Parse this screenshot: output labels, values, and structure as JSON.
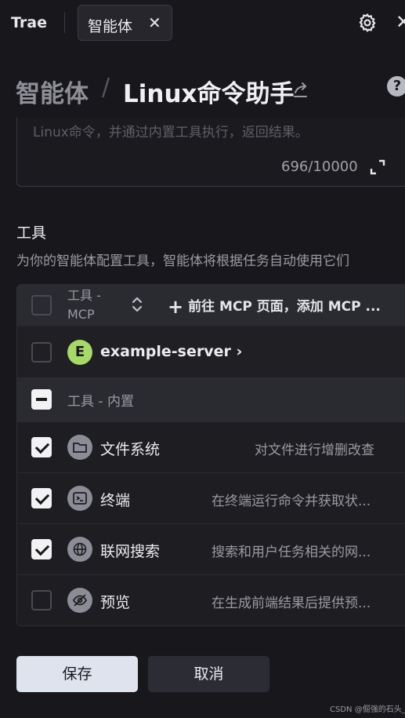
{
  "topbar": {
    "app_name": "Trae",
    "tab_label": "智能体",
    "tab_close": "✕",
    "window_close": "✕"
  },
  "header": {
    "breadcrumb_root": "智能体",
    "breadcrumb_sep": "/",
    "page_title": "Linux命令助手",
    "help": "?"
  },
  "prompt": {
    "text_fragment": "Linux命令，并通过内置工具执行，返回结果。",
    "counter": "696/10000"
  },
  "tools": {
    "title": "工具",
    "description": "为你的智能体配置工具，智能体将根据任务自动使用它们",
    "header": {
      "column_label": "工具 - MCP",
      "add_mcp_label": "前往 MCP 页面，添加 MCP ...",
      "add_icon": "+"
    },
    "server": {
      "avatar_letter": "E",
      "name": "example-server",
      "chevron": "›"
    },
    "builtin_group": "工具 - 内置",
    "items": [
      {
        "name": "文件系统",
        "description": "对文件进行增删改查",
        "checked": true,
        "icon": "folder-icon"
      },
      {
        "name": "终端",
        "description": "在终端运行命令并获取状...",
        "checked": true,
        "icon": "terminal-icon"
      },
      {
        "name": "联网搜索",
        "description": "搜索和用户任务相关的网...",
        "checked": true,
        "icon": "globe-icon"
      },
      {
        "name": "预览",
        "description": "在生成前端结果后提供预...",
        "checked": false,
        "icon": "eye-icon"
      }
    ]
  },
  "actions": {
    "save_label": "保存",
    "cancel_label": "取消"
  },
  "watermark": "CSDN @倔强的石头_",
  "colors": {
    "background": "#18181c",
    "server_avatar": "#a8d86a",
    "primary_button": "#dfe3ee"
  }
}
